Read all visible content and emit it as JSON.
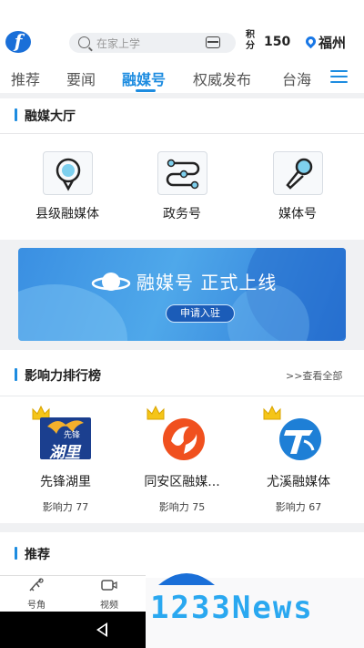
{
  "header": {
    "logo_letter": "f",
    "search_placeholder": "在家上学",
    "points_label": "积分",
    "points_value": "150",
    "location": "福州"
  },
  "tabs": [
    {
      "label": "推荐",
      "active": false
    },
    {
      "label": "要闻",
      "active": false
    },
    {
      "label": "融媒号",
      "active": true
    },
    {
      "label": "权威发布",
      "active": false
    },
    {
      "label": "台海",
      "active": false
    }
  ],
  "hall": {
    "title": "融媒大厅",
    "categories": [
      {
        "label": "县级融媒体",
        "icon": "location-pin-icon"
      },
      {
        "label": "政务号",
        "icon": "route-nodes-icon"
      },
      {
        "label": "媒体号",
        "icon": "microphone-icon"
      }
    ]
  },
  "banner": {
    "title": "融媒号 正式上线",
    "button": "申请入驻"
  },
  "ranking": {
    "title": "影响力排行榜",
    "more": ">>查看全部",
    "items": [
      {
        "name": "先锋湖里",
        "score": "影响力 77",
        "logo_text": "湖里",
        "logo_sub": "先锋"
      },
      {
        "name": "同安区融媒...",
        "score": "影响力 75"
      },
      {
        "name": "尤溪融媒体",
        "score": "影响力 67"
      }
    ]
  },
  "recommend": {
    "title": "推荐"
  },
  "bottom_nav": [
    {
      "label": "号角",
      "icon": "horn-icon"
    },
    {
      "label": "视频",
      "icon": "video-icon"
    }
  ],
  "watermark": "1233News",
  "colors": {
    "accent": "#1d8ce0",
    "banner": "#3a8fe2",
    "crown": "#f5c518"
  }
}
